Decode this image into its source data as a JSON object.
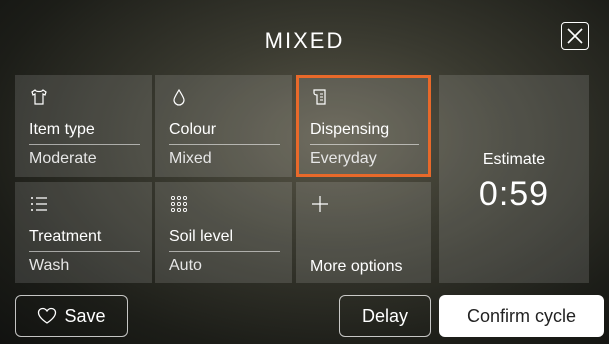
{
  "header": {
    "title": "MIXED"
  },
  "tiles": [
    {
      "label": "Item type",
      "value": "Moderate",
      "icon": "shirt-icon"
    },
    {
      "label": "Colour",
      "value": "Mixed",
      "icon": "droplet-icon"
    },
    {
      "label": "Dispensing",
      "value": "Everyday",
      "icon": "detergent-icon"
    },
    {
      "label": "Treatment",
      "value": "Wash",
      "icon": "list-icon"
    },
    {
      "label": "Soil level",
      "value": "Auto",
      "icon": "dots-grid-icon"
    },
    {
      "label": "More options",
      "icon": "plus-icon"
    }
  ],
  "estimate": {
    "label": "Estimate",
    "value": "0:59"
  },
  "footer": {
    "save": "Save",
    "delay": "Delay",
    "confirm": "Confirm cycle"
  },
  "colors": {
    "selected": "#e8692a",
    "tile": "rgba(255,255,255,0.13)"
  }
}
